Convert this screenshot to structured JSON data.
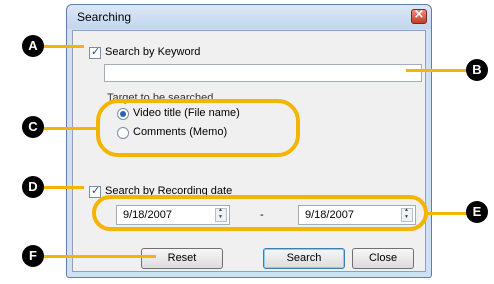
{
  "dialog": {
    "title": "Searching",
    "keyword_checkbox_label": "Search by Keyword",
    "keyword_value": "",
    "target_label": "Target to be searched",
    "radio_video_title": "Video title (File name)",
    "radio_comments": "Comments (Memo)",
    "date_checkbox_label": "Search by Recording date",
    "date_from": "9/18/2007",
    "date_separator": "-",
    "date_to": "9/18/2007",
    "reset_label": "Reset",
    "search_label": "Search",
    "close_label": "Close"
  },
  "callouts": {
    "a": "A",
    "b": "B",
    "c": "C",
    "d": "D",
    "e": "E",
    "f": "F"
  },
  "colors": {
    "callout_accent": "#f5b400",
    "callout_marker": "#000000"
  }
}
